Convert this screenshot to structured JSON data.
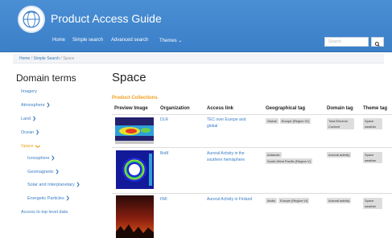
{
  "header": {
    "title": "Product Access Guide",
    "nav": {
      "home": "Home",
      "simple": "Simple search",
      "advanced": "Advanced search",
      "themes": "Themes ⌄"
    },
    "search_placeholder": "Search",
    "search_icon": "magnifier-icon",
    "accent": "#3b7fc8"
  },
  "breadcrumb": {
    "home": "Home",
    "sep1": " / ",
    "simple": "Simple Search",
    "sep2": " / ",
    "current": "Space"
  },
  "sidebar": {
    "title": "Domain terms",
    "items": [
      {
        "label": "Imagery",
        "chev": ""
      },
      {
        "label": "Atmosphere",
        "chev": "❯"
      },
      {
        "label": "Land",
        "chev": "❯"
      },
      {
        "label": "Ocean",
        "chev": "❯"
      },
      {
        "label": "Space",
        "chev": "❯"
      },
      {
        "label": "Ionosphere",
        "chev": "❯"
      },
      {
        "label": "Geomagnetic",
        "chev": "❯"
      },
      {
        "label": "Solar and Interplanetary",
        "chev": "❯"
      },
      {
        "label": "Energetic Particles",
        "chev": "❯"
      },
      {
        "label": "Access to top level data",
        "chev": ""
      }
    ]
  },
  "main": {
    "title": "Space",
    "collections_label": "Product Collections",
    "columns": [
      "Preview Image",
      "Organization",
      "Access link",
      "Geographical tag",
      "Domain tag",
      "Theme tag"
    ],
    "rows": [
      {
        "org": "DLR",
        "link": "TEC over Europe and global",
        "geo": [
          "Global",
          "Europe (Region VI)"
        ],
        "domain": "Total Electron Content",
        "theme": "Space weather"
      },
      {
        "org": "BoM",
        "link": "Auroral Activity in the southern hemisphere",
        "geo": [
          "Antarctic",
          "South-West Pacific (Region V)"
        ],
        "domain": "Auroral activity",
        "theme": "Space weather"
      },
      {
        "org": "FMI",
        "link": "Auroral Activity in Finland",
        "geo": [
          "Arctic",
          "Europe (Region VI)"
        ],
        "domain": "Auroral activity",
        "theme": "Space weather"
      }
    ]
  }
}
